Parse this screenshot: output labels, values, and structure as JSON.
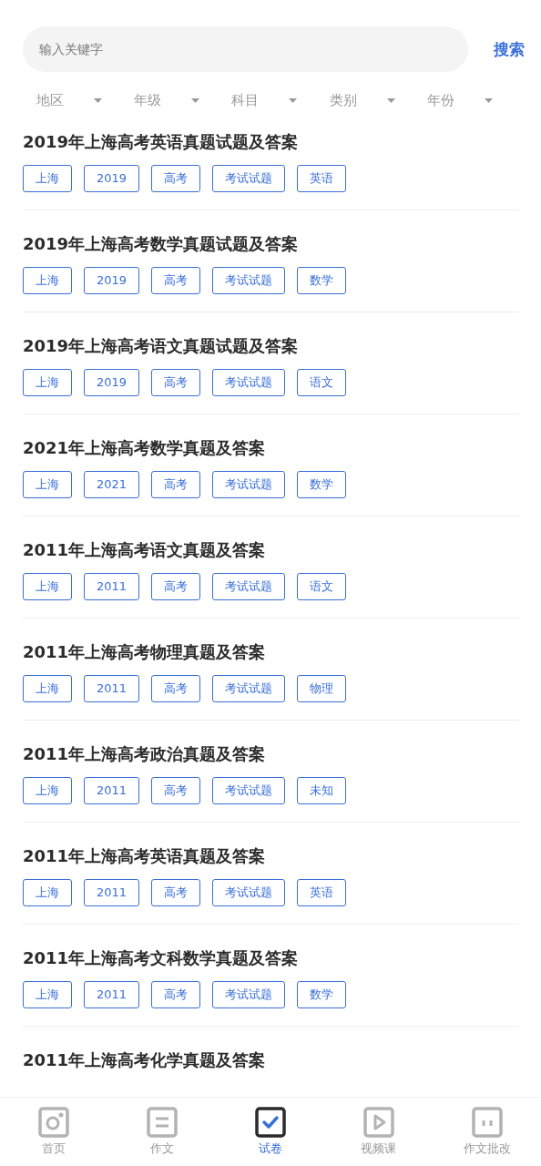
{
  "search": {
    "placeholder": "输入关键字",
    "button": "搜索"
  },
  "filters": [
    {
      "label": "地区"
    },
    {
      "label": "年级"
    },
    {
      "label": "科目"
    },
    {
      "label": "类别"
    },
    {
      "label": "年份"
    }
  ],
  "papers": [
    {
      "title": "2019年上海高考英语真题试题及答案",
      "tags": [
        "上海",
        "2019",
        "高考",
        "考试试题",
        "英语"
      ]
    },
    {
      "title": "2019年上海高考数学真题试题及答案",
      "tags": [
        "上海",
        "2019",
        "高考",
        "考试试题",
        "数学"
      ]
    },
    {
      "title": "2019年上海高考语文真题试题及答案",
      "tags": [
        "上海",
        "2019",
        "高考",
        "考试试题",
        "语文"
      ]
    },
    {
      "title": "2021年上海高考数学真题及答案",
      "tags": [
        "上海",
        "2021",
        "高考",
        "考试试题",
        "数学"
      ]
    },
    {
      "title": "2011年上海高考语文真题及答案",
      "tags": [
        "上海",
        "2011",
        "高考",
        "考试试题",
        "语文"
      ]
    },
    {
      "title": "2011年上海高考物理真题及答案",
      "tags": [
        "上海",
        "2011",
        "高考",
        "考试试题",
        "物理"
      ]
    },
    {
      "title": "2011年上海高考政治真题及答案",
      "tags": [
        "上海",
        "2011",
        "高考",
        "考试试题",
        "未知"
      ]
    },
    {
      "title": "2011年上海高考英语真题及答案",
      "tags": [
        "上海",
        "2011",
        "高考",
        "考试试题",
        "英语"
      ]
    },
    {
      "title": "2011年上海高考文科数学真题及答案",
      "tags": [
        "上海",
        "2011",
        "高考",
        "考试试题",
        "数学"
      ]
    },
    {
      "title": "2011年上海高考化学真题及答案"
    }
  ],
  "nav": [
    {
      "label": "首页",
      "selected": false
    },
    {
      "label": "作文",
      "selected": false
    },
    {
      "label": "试卷",
      "selected": true
    },
    {
      "label": "视频课",
      "selected": false
    },
    {
      "label": "作文批改",
      "selected": false
    }
  ]
}
